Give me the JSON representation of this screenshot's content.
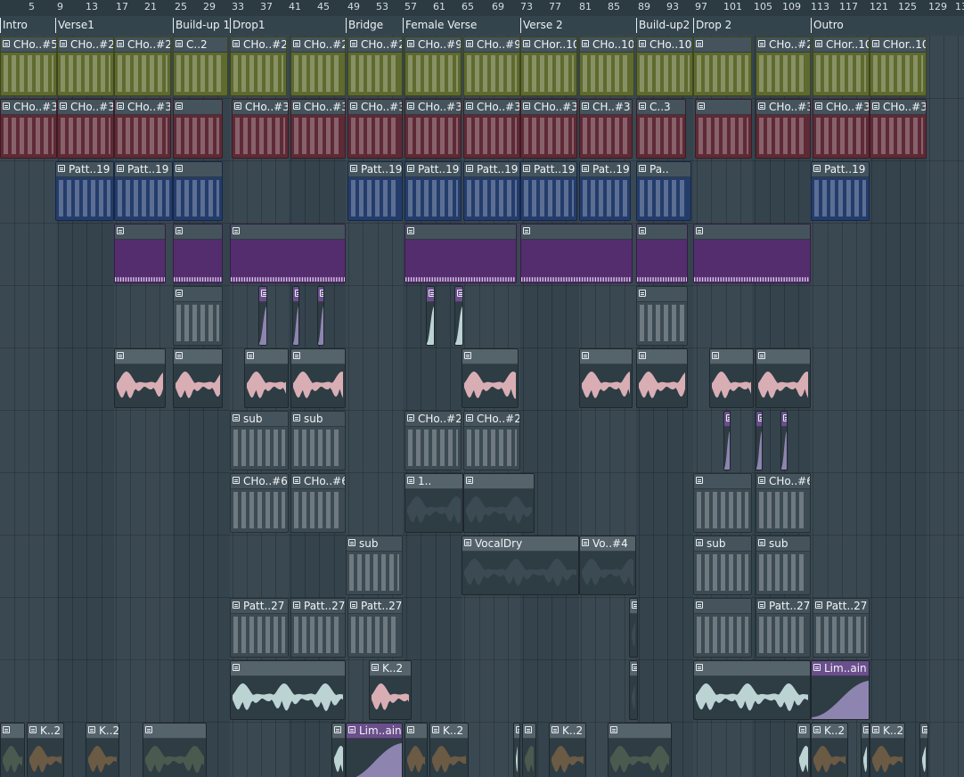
{
  "window": {
    "name": "Playlist"
  },
  "ruler": {
    "bars": [
      "5",
      "9",
      "13",
      "17",
      "21",
      "25",
      "29",
      "33",
      "37",
      "41",
      "45",
      "49",
      "53",
      "57",
      "61",
      "65",
      "69",
      "73",
      "77",
      "81",
      "85",
      "89",
      "93",
      "97",
      "101",
      "105",
      "109",
      "113",
      "117",
      "121",
      "125",
      "129",
      "13"
    ]
  },
  "markers": [
    "Intro",
    "Verse1",
    "Build-up 1",
    "Drop1",
    "Bridge",
    "Female Verse",
    "Verse 2",
    "Build-up2",
    "Drop 2",
    "Outro"
  ],
  "colors": {
    "olive": "#5e6a2e",
    "maroon": "#5e2a36",
    "navy": "#233c6b",
    "purple": "#542d6e",
    "slate": "#3b4a53",
    "pink": "#d8aeb4",
    "mint": "#bcd3d4",
    "lightpurple": "#8e84b0",
    "brown": "#6b5a44",
    "greygreen": "#4a5a4f"
  },
  "tracks": [
    {
      "id": "t1",
      "clips": [
        "CHo..#5",
        "CHo..#2",
        "CHo..#2",
        "C..2",
        "CHo..#2",
        "CHo..#2",
        "CHo..#2",
        "CHo..#9",
        "CHo..#9",
        "CHor..10",
        "CHo..10",
        "CHo..10",
        "CHo..#2",
        "CHor..10",
        "CHor..10"
      ]
    },
    {
      "id": "t2",
      "clips": [
        "CHo..#3",
        "CHo..#3",
        "CHo..#3",
        "CHo..#3",
        "CHo..#3",
        "CHo..#3",
        "CHo..#3",
        "CHo..#3",
        "CHo..#3",
        "CH..#3",
        "C..3",
        "CHo..#3",
        "CHo..#3",
        "CHo..#3"
      ]
    },
    {
      "id": "t3",
      "clips": [
        "Patt..19",
        "Patt..19",
        "Patt..19",
        "Patt..19",
        "Patt..19",
        "Patt..19",
        "Pat..19",
        "Pa..",
        "Patt..19"
      ]
    },
    {
      "id": "t4",
      "clips": []
    },
    {
      "id": "t5",
      "clips": []
    },
    {
      "id": "t6",
      "clips": []
    },
    {
      "id": "t7",
      "clips": [
        "sub",
        "sub",
        "CHo..#2",
        "CHo..#2"
      ]
    },
    {
      "id": "t8",
      "clips": [
        "CHo..#6",
        "CHo..#6",
        "1..",
        "CHo..#6"
      ]
    },
    {
      "id": "t9",
      "clips": [
        "sub",
        "VocalDry",
        "Vo..#4",
        "sub",
        "sub"
      ]
    },
    {
      "id": "t10",
      "clips": [
        "Patt..27",
        "Patt..27",
        "Patt..27",
        "Patt..27",
        "Patt..27"
      ]
    },
    {
      "id": "t11",
      "clips": [
        "K..2",
        "Lim..ain"
      ]
    },
    {
      "id": "t12",
      "clips": [
        "K..2",
        "K..2",
        "Lim..ain",
        "K..2",
        "K..2",
        "K..2",
        "K..2"
      ]
    }
  ]
}
